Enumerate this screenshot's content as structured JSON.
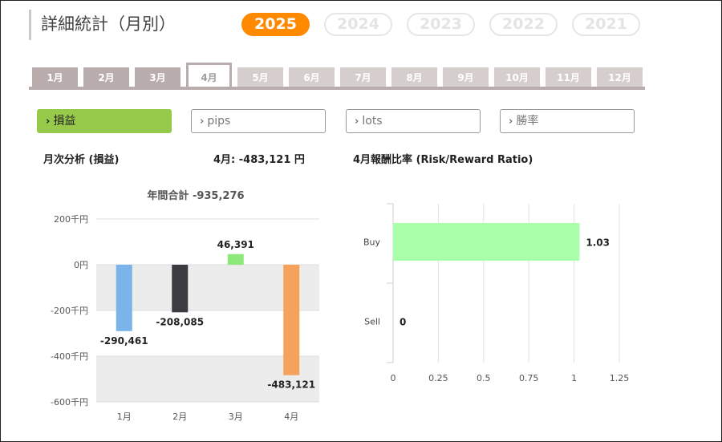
{
  "header": {
    "title": "詳細統計（月別）"
  },
  "years": [
    {
      "label": "2025",
      "active": true
    },
    {
      "label": "2024",
      "active": false
    },
    {
      "label": "2023",
      "active": false
    },
    {
      "label": "2022",
      "active": false
    },
    {
      "label": "2021",
      "active": false
    }
  ],
  "months": [
    "1月",
    "2月",
    "3月",
    "4月",
    "5月",
    "6月",
    "7月",
    "8月",
    "9月",
    "10月",
    "11月",
    "12月"
  ],
  "selected_month_index": 3,
  "filters": [
    {
      "label": "損益",
      "active": true
    },
    {
      "label": "pips",
      "active": false
    },
    {
      "label": "lots",
      "active": false
    },
    {
      "label": "勝率",
      "active": false
    }
  ],
  "monthly": {
    "heading": "月次分析 (損益)",
    "month_total": "4月:  -483,121 円"
  },
  "ratio": {
    "heading": "4月報酬比率 (Risk/Reward Ratio)"
  },
  "chart_data": [
    {
      "type": "bar",
      "title": "年間合計 -935,276",
      "categories": [
        "1月",
        "2月",
        "3月",
        "4月"
      ],
      "values": [
        -290461,
        -208085,
        46391,
        -483121
      ],
      "value_labels": [
        "-290,461",
        "-208,085",
        "46,391",
        "-483,121"
      ],
      "bar_colors": [
        "#7ab4ea",
        "#3b3b40",
        "#8ee87a",
        "#f5a25d"
      ],
      "yticks": [
        200000,
        0,
        -200000,
        -400000,
        -600000
      ],
      "ytick_labels": [
        "200千円",
        "0円",
        "-200千円",
        "-400千円",
        "-600千円"
      ],
      "ylim": [
        -600000,
        200000
      ],
      "xlabel": "",
      "ylabel": ""
    },
    {
      "type": "bar",
      "orientation": "horizontal",
      "categories": [
        "Buy",
        "Sell"
      ],
      "values": [
        1.03,
        0
      ],
      "value_labels": [
        "1.03",
        "0"
      ],
      "bar_color": "#aaffaa",
      "xticks": [
        0,
        0.25,
        0.5,
        0.75,
        1,
        1.25
      ],
      "xtick_labels": [
        "0",
        "0.25",
        "0.5",
        "0.75",
        "1",
        "1.25"
      ],
      "xlim": [
        0,
        1.25
      ],
      "xlabel": "",
      "ylabel": ""
    }
  ]
}
